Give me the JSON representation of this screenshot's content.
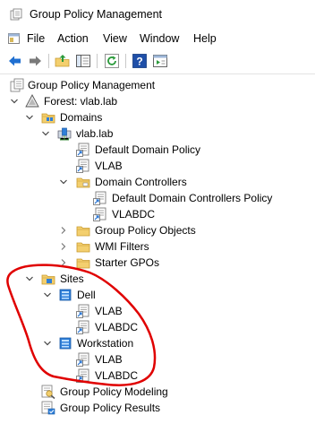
{
  "window": {
    "title": "Group Policy Management"
  },
  "menu": {
    "items": [
      "File",
      "Action",
      "View",
      "Window",
      "Help"
    ]
  },
  "toolbar": {
    "buttons": [
      "back-icon",
      "forward-icon",
      "up-folder-icon",
      "show-hide-tree-icon",
      "refresh-icon",
      "help-icon",
      "properties-icon"
    ]
  },
  "tree": {
    "root": "Group Policy Management",
    "forest": "Forest: vlab.lab",
    "domains": "Domains",
    "domain": "vlab.lab",
    "default_domain_policy": "Default Domain Policy",
    "vlab_gpo": "VLAB",
    "domain_controllers": "Domain Controllers",
    "default_dc_policy": "Default Domain Controllers Policy",
    "vlabdc_gpo": "VLABDC",
    "gpo_container": "Group Policy Objects",
    "wmi_filters": "WMI Filters",
    "starter_gpos": "Starter GPOs",
    "sites": "Sites",
    "site_dell": "Dell",
    "site_dell_vlab": "VLAB",
    "site_dell_vlabdc": "VLABDC",
    "site_workstation": "Workstation",
    "site_ws_vlab": "VLAB",
    "site_ws_vlabdc": "VLABDC",
    "modeling": "Group Policy Modeling",
    "results": "Group Policy Results"
  },
  "colors": {
    "annotation": "#e00000",
    "folder": "#e8c15a",
    "link_arrow": "#1f6fd1"
  }
}
